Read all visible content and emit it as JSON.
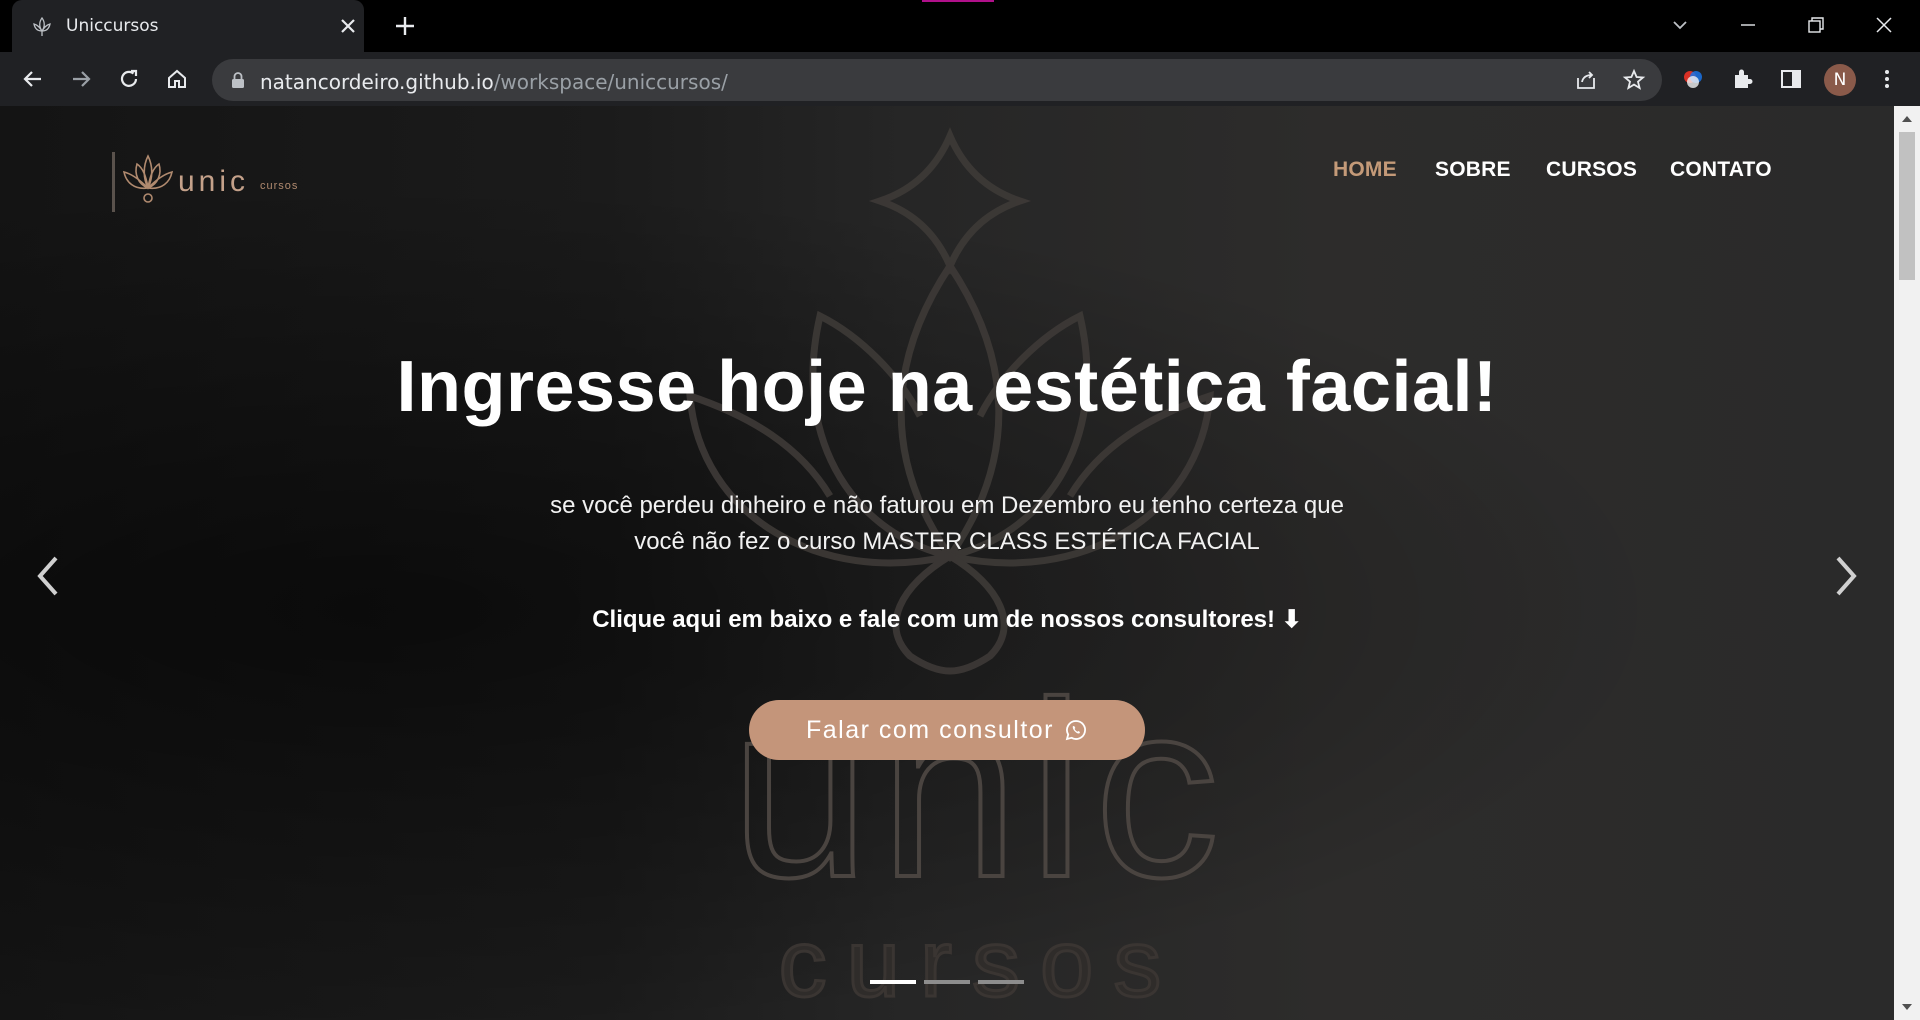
{
  "browser": {
    "tab_title": "Uniccursos",
    "url_host": "natancordeiro.github.io",
    "url_path": "/workspace/uniccursos/",
    "profile_initial": "N"
  },
  "site": {
    "nav": [
      {
        "label": "HOME",
        "active": true
      },
      {
        "label": "SOBRE",
        "active": false
      },
      {
        "label": "CURSOS",
        "active": false
      },
      {
        "label": "CONTATO",
        "active": false
      }
    ],
    "logo": {
      "main": "unic",
      "small": "cursos"
    },
    "hero": {
      "headline": "Ingresse hoje na estética facial!",
      "sub_line1": "se você perdeu dinheiro e não faturou em Dezembro eu tenho certeza que",
      "sub_line2": "você não fez o curso MASTER CLASS ESTÉTICA FACIAL",
      "cta_text": "Clique aqui em baixo e fale com um de nossos consultores! ⬇",
      "button_label": "Falar com consultor"
    },
    "watermark": {
      "main": "unic",
      "small": "cursos"
    },
    "carousel": {
      "slides": 3,
      "active_index": 0
    }
  },
  "colors": {
    "accent": "#c4957a",
    "nav_active": "#c49a78"
  },
  "icons": [
    "lotus-icon",
    "close-icon",
    "plus-icon",
    "back-icon",
    "forward-icon",
    "reload-icon",
    "home-icon",
    "lock-icon",
    "share-icon",
    "star-icon",
    "extensions-icon",
    "side-panel-icon",
    "whatsapp-icon",
    "chevron-left-icon",
    "chevron-right-icon"
  ]
}
